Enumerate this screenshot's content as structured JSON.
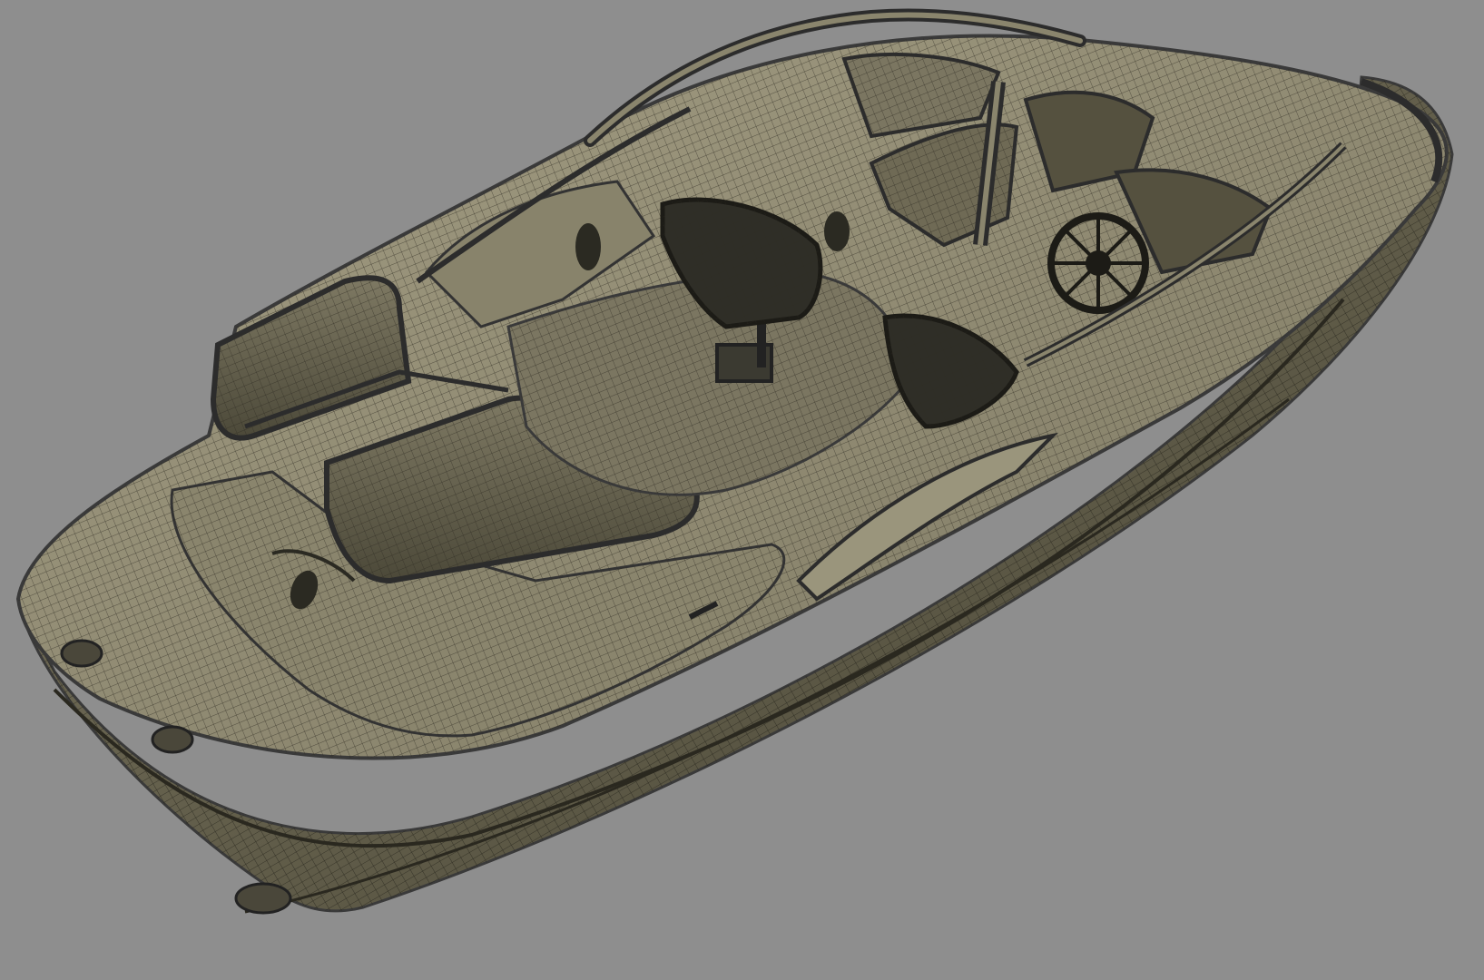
{
  "viewport": {
    "background": "#8e8e8e",
    "model": "boat-wireframe-mesh",
    "colors": {
      "hull": "#57533f",
      "deck": "#8f8a72",
      "mesh_line": "#2e2c22",
      "edge": "#3a3a3a",
      "seat": "#3b3a31",
      "dark": "#1c1b16"
    }
  }
}
